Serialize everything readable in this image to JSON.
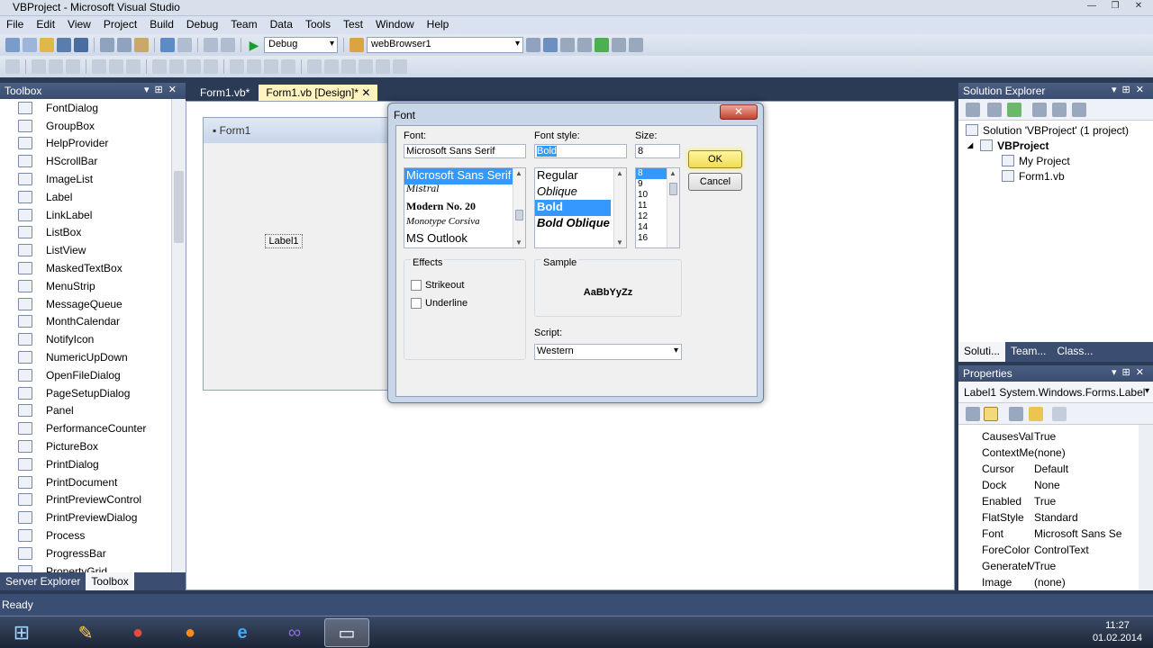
{
  "window": {
    "title": "VBProject - Microsoft Visual Studio"
  },
  "menu": [
    "File",
    "Edit",
    "View",
    "Project",
    "Build",
    "Debug",
    "Team",
    "Data",
    "Tools",
    "Test",
    "Window",
    "Help"
  ],
  "toolbar": {
    "config": "Debug",
    "target": "webBrowser1"
  },
  "toolbox": {
    "title": "Toolbox",
    "items": [
      "FontDialog",
      "GroupBox",
      "HelpProvider",
      "HScrollBar",
      "ImageList",
      "Label",
      "LinkLabel",
      "ListBox",
      "ListView",
      "MaskedTextBox",
      "MenuStrip",
      "MessageQueue",
      "MonthCalendar",
      "NotifyIcon",
      "NumericUpDown",
      "OpenFileDialog",
      "PageSetupDialog",
      "Panel",
      "PerformanceCounter",
      "PictureBox",
      "PrintDialog",
      "PrintDocument",
      "PrintPreviewControl",
      "PrintPreviewDialog",
      "Process",
      "ProgressBar",
      "PropertyGrid"
    ],
    "bottom_tabs": [
      "Server Explorer",
      "Toolbox"
    ]
  },
  "doc_tabs": [
    "Form1.vb*",
    "Form1.vb [Design]*"
  ],
  "designer": {
    "form_title": "Form1",
    "label": "Label1"
  },
  "font_dialog": {
    "title": "Font",
    "font_label": "Font:",
    "font_value": "Microsoft Sans Serif",
    "fonts": [
      "Microsoft Sans Serif",
      "Mistral",
      "Modern No. 20",
      "Monotype Corsiva",
      "MS Outlook"
    ],
    "style_label": "Font style:",
    "style_value": "Bold",
    "styles": [
      "Regular",
      "Oblique",
      "Bold",
      "Bold Oblique"
    ],
    "size_label": "Size:",
    "size_value": "8",
    "sizes": [
      "8",
      "9",
      "10",
      "11",
      "12",
      "14",
      "16"
    ],
    "ok": "OK",
    "cancel": "Cancel",
    "effects_label": "Effects",
    "strikeout": "Strikeout",
    "underline": "Underline",
    "sample_label": "Sample",
    "sample_text": "AaBbYyZz",
    "script_label": "Script:",
    "script_value": "Western"
  },
  "solution_explorer": {
    "title": "Solution Explorer",
    "nodes": [
      "Solution 'VBProject' (1 project)",
      "VBProject",
      "My Project",
      "Form1.vb"
    ],
    "tabs": [
      "Soluti...",
      "Team...",
      "Class..."
    ]
  },
  "properties": {
    "title": "Properties",
    "object": "Label1 System.Windows.Forms.Label",
    "rows": [
      {
        "name": "CausesValidatio",
        "value": "True"
      },
      {
        "name": "ContextMenuStri",
        "value": "(none)"
      },
      {
        "name": "Cursor",
        "value": "Default"
      },
      {
        "name": "Dock",
        "value": "None"
      },
      {
        "name": "Enabled",
        "value": "True"
      },
      {
        "name": "FlatStyle",
        "value": "Standard"
      },
      {
        "name": "Font",
        "value": "Microsoft Sans Se"
      },
      {
        "name": "ForeColor",
        "value": "ControlText"
      },
      {
        "name": "GenerateMembe",
        "value": "True"
      },
      {
        "name": "Image",
        "value": "(none)"
      }
    ]
  },
  "status": {
    "text": "Ready"
  },
  "taskbar": {
    "time": "11:27",
    "date": "01.02.2014"
  }
}
